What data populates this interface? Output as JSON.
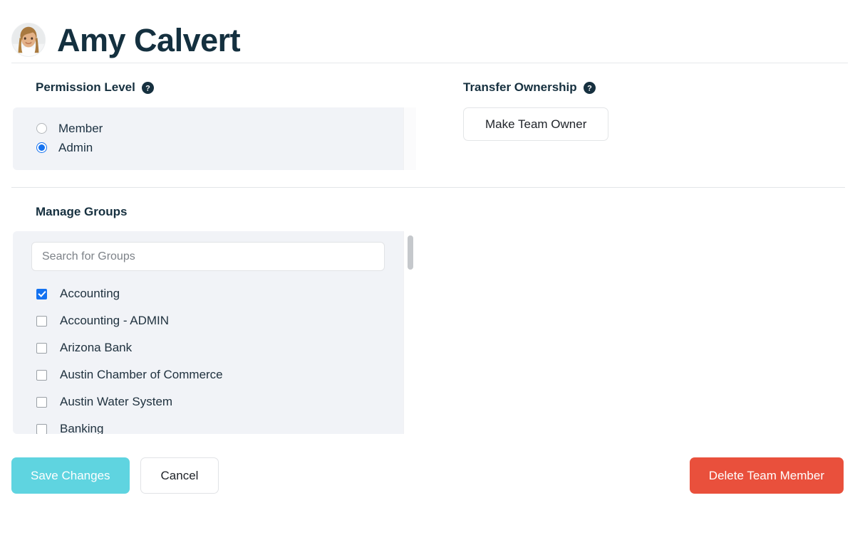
{
  "header": {
    "member_name": "Amy Calvert",
    "avatar_name": "avatar-amy-calvert"
  },
  "permission": {
    "title": "Permission Level",
    "help_icon": "help-circle-icon",
    "options": [
      {
        "label": "Member",
        "selected": false
      },
      {
        "label": "Admin",
        "selected": true
      }
    ]
  },
  "transfer": {
    "title": "Transfer Ownership",
    "help_icon": "help-circle-icon",
    "button_label": "Make Team Owner"
  },
  "groups": {
    "title": "Manage Groups",
    "search_placeholder": "Search for Groups",
    "search_value": "",
    "items": [
      {
        "label": "Accounting",
        "checked": true
      },
      {
        "label": "Accounting - ADMIN",
        "checked": false
      },
      {
        "label": "Arizona Bank",
        "checked": false
      },
      {
        "label": "Austin Chamber of Commerce",
        "checked": false
      },
      {
        "label": "Austin Water System",
        "checked": false
      },
      {
        "label": "Banking",
        "checked": false
      }
    ]
  },
  "footer": {
    "save_label": "Save Changes",
    "cancel_label": "Cancel",
    "delete_label": "Delete Team Member"
  },
  "colors": {
    "accent_blue": "#1472f0",
    "save_teal": "#5fd4e0",
    "delete_red": "#e9503c",
    "panel_bg": "#f1f3f7",
    "text_dark": "#16303f"
  }
}
